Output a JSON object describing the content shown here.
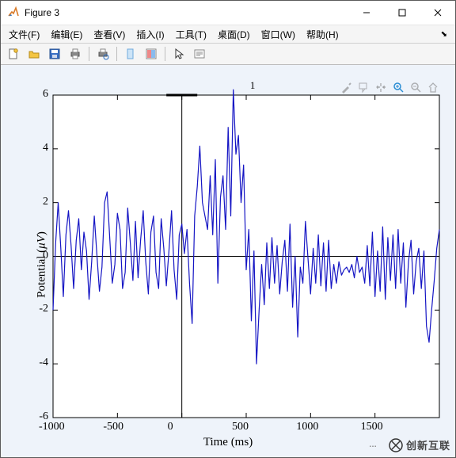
{
  "window": {
    "title": "Figure 3"
  },
  "menubar": {
    "items": [
      {
        "label": "文件(F)"
      },
      {
        "label": "编辑(E)"
      },
      {
        "label": "查看(V)"
      },
      {
        "label": "插入(I)"
      },
      {
        "label": "工具(T)"
      },
      {
        "label": "桌面(D)"
      },
      {
        "label": "窗口(W)"
      },
      {
        "label": "帮助(H)"
      }
    ]
  },
  "toolbar": {
    "icons": [
      "new-file-icon",
      "open-folder-icon",
      "save-icon",
      "print-icon",
      "sep",
      "print-preview-icon",
      "sep",
      "data-cursor-icon",
      "colorbar-icon",
      "sep",
      "pointer-icon",
      "insert-text-icon"
    ]
  },
  "axes_toolbar": [
    "brush-icon",
    "datatip-icon",
    "pan-icon",
    "zoom-in-icon",
    "zoom-out-icon",
    "home-icon"
  ],
  "labels": {
    "ylabel_pre": "Potential (",
    "ylabel_unit": "μV",
    "ylabel_post": ")",
    "xlabel": "Time (ms)",
    "series": "1"
  },
  "watermark": {
    "icon": "wechat-icon",
    "text": "创新互联"
  },
  "chart_data": {
    "type": "line",
    "xlabel": "Time (ms)",
    "ylabel": "Potential (μV)",
    "xlim": [
      -1000,
      2000
    ],
    "ylim": [
      -6,
      6
    ],
    "xticks": [
      -1000,
      -500,
      0,
      500,
      1000,
      1500
    ],
    "yticks": [
      -6,
      -4,
      -2,
      0,
      2,
      4,
      6
    ],
    "legend": [
      "1"
    ],
    "series": [
      {
        "name": "1",
        "color": "#1515c4",
        "x": [
          -1000,
          -980,
          -960,
          -940,
          -920,
          -900,
          -880,
          -860,
          -840,
          -820,
          -800,
          -780,
          -760,
          -740,
          -720,
          -700,
          -680,
          -660,
          -640,
          -620,
          -600,
          -580,
          -560,
          -540,
          -520,
          -500,
          -480,
          -460,
          -440,
          -420,
          -400,
          -380,
          -360,
          -340,
          -320,
          -300,
          -280,
          -260,
          -240,
          -220,
          -200,
          -180,
          -160,
          -140,
          -120,
          -100,
          -80,
          -60,
          -40,
          -20,
          0,
          20,
          40,
          60,
          80,
          100,
          120,
          140,
          160,
          180,
          200,
          220,
          240,
          260,
          280,
          300,
          320,
          340,
          360,
          380,
          400,
          420,
          440,
          460,
          480,
          500,
          520,
          540,
          560,
          580,
          600,
          620,
          640,
          660,
          680,
          700,
          720,
          740,
          760,
          780,
          800,
          820,
          840,
          860,
          880,
          900,
          920,
          940,
          960,
          980,
          1000,
          1020,
          1040,
          1060,
          1080,
          1100,
          1120,
          1140,
          1160,
          1180,
          1200,
          1220,
          1240,
          1260,
          1280,
          1300,
          1320,
          1340,
          1360,
          1380,
          1400,
          1420,
          1440,
          1460,
          1480,
          1500,
          1520,
          1540,
          1560,
          1580,
          1600,
          1620,
          1640,
          1660,
          1680,
          1700,
          1720,
          1740,
          1760,
          1780,
          1800,
          1820,
          1840,
          1860,
          1880,
          1900,
          1920,
          1940,
          1960,
          1980,
          2000
        ],
        "y": [
          -2.0,
          0.5,
          2.0,
          0.3,
          -1.5,
          0.8,
          1.7,
          0.4,
          -1.2,
          0.6,
          1.4,
          -0.5,
          0.9,
          0.2,
          -1.6,
          -0.2,
          1.5,
          0.1,
          -1.3,
          -0.4,
          2.0,
          2.4,
          0.7,
          -1.0,
          -0.3,
          1.6,
          1.0,
          -1.2,
          -0.6,
          1.8,
          0.5,
          -0.9,
          1.3,
          -0.8,
          0.6,
          1.7,
          -0.2,
          -1.4,
          0.9,
          1.5,
          -0.6,
          -1.2,
          1.4,
          0.3,
          -1.1,
          0.2,
          1.7,
          -0.5,
          -1.6,
          0.8,
          1.2,
          0.1,
          1.0,
          -1.0,
          -2.5,
          1.5,
          2.6,
          4.1,
          2.0,
          1.5,
          1.0,
          3.0,
          0.8,
          3.6,
          -1.0,
          2.2,
          3.0,
          1.0,
          4.8,
          1.5,
          6.2,
          3.8,
          4.5,
          2.0,
          3.4,
          -0.5,
          1.0,
          -2.4,
          0.2,
          -4.0,
          -2.0,
          -0.3,
          -1.8,
          0.5,
          -1.2,
          0.7,
          -1.0,
          0.4,
          -1.4,
          -0.2,
          0.6,
          -1.3,
          1.2,
          -1.9,
          0.0,
          -3.0,
          -0.4,
          -1.0,
          1.3,
          -0.1,
          -1.4,
          0.3,
          -1.0,
          0.8,
          -1.1,
          0.5,
          -1.3,
          0.6,
          -1.2,
          -0.3,
          -1.0,
          -0.2,
          -0.7,
          -0.5,
          -0.4,
          -0.6,
          -0.3,
          -0.8,
          0.0,
          -0.6,
          -0.4,
          -1.0,
          0.4,
          -1.1,
          0.9,
          -1.5,
          0.2,
          -1.3,
          1.1,
          -1.6,
          0.7,
          -0.9,
          0.8,
          -1.2,
          1.0,
          -1.0,
          0.5,
          -1.9,
          -0.2,
          0.6,
          -1.4,
          -0.2,
          0.3,
          -1.2,
          0.2,
          -2.6,
          -3.2,
          -2.0,
          -0.9,
          0.3,
          1.0
        ]
      }
    ]
  }
}
